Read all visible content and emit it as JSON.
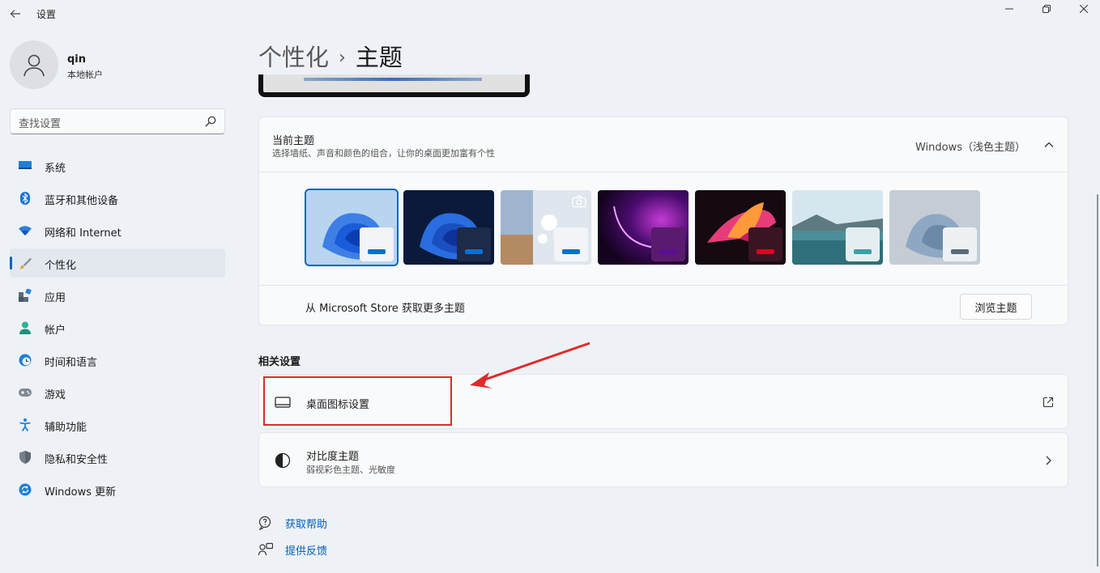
{
  "window": {
    "title": "设置",
    "back_icon": "back-arrow-icon",
    "controls": [
      "minimize-icon",
      "maximize-icon",
      "close-icon"
    ]
  },
  "user": {
    "name": "qin",
    "account_type": "本地帐户"
  },
  "search": {
    "placeholder": "查找设置"
  },
  "sidebar": {
    "items": [
      {
        "label": "系统",
        "icon": "system-icon",
        "active": false
      },
      {
        "label": "蓝牙和其他设备",
        "icon": "bluetooth-icon",
        "active": false
      },
      {
        "label": "网络和 Internet",
        "icon": "wifi-icon",
        "active": false
      },
      {
        "label": "个性化",
        "icon": "brush-icon",
        "active": true
      },
      {
        "label": "应用",
        "icon": "apps-icon",
        "active": false
      },
      {
        "label": "帐户",
        "icon": "account-icon",
        "active": false
      },
      {
        "label": "时间和语言",
        "icon": "globe-clock-icon",
        "active": false
      },
      {
        "label": "游戏",
        "icon": "gamepad-icon",
        "active": false
      },
      {
        "label": "辅助功能",
        "icon": "accessibility-icon",
        "active": false
      },
      {
        "label": "隐私和安全性",
        "icon": "shield-icon",
        "active": false
      },
      {
        "label": "Windows 更新",
        "icon": "update-icon",
        "active": false
      }
    ]
  },
  "breadcrumb": {
    "parent": "个性化",
    "separator": "›",
    "current": "主题"
  },
  "current_theme": {
    "title": "当前主题",
    "description": "选择墙纸、声音和颜色的组合，让你的桌面更加富有个性",
    "value": "Windows（浅色主题）",
    "themes": [
      {
        "name": "windows-light",
        "selected": true,
        "bar_color": "#0a6fd1"
      },
      {
        "name": "windows-dark",
        "selected": false,
        "bar_color": "#0a6fd1"
      },
      {
        "name": "glow",
        "selected": false,
        "bar_color": "#0a6fd1"
      },
      {
        "name": "captured-motion",
        "selected": false,
        "bar_color": "#5a0f96"
      },
      {
        "name": "flow",
        "selected": false,
        "bar_color": "#e0001f"
      },
      {
        "name": "sunrise",
        "selected": false,
        "bar_color": "#3aa0a8"
      },
      {
        "name": "bloom",
        "selected": false,
        "bar_color": "#5d6a78"
      }
    ],
    "store_text": "从 Microsoft Store 获取更多主题",
    "browse_button": "浏览主题"
  },
  "related_settings": {
    "title": "相关设置",
    "items": [
      {
        "title": "桌面图标设置",
        "subtitle": "",
        "icon": "monitor-icon",
        "trail_icon": "external-link-icon"
      },
      {
        "title": "对比度主题",
        "subtitle": "弱视彩色主题、光敏度",
        "icon": "contrast-icon",
        "trail_icon": "chevron-right-icon"
      }
    ]
  },
  "links": [
    {
      "label": "获取帮助",
      "icon": "help-icon"
    },
    {
      "label": "提供反馈",
      "icon": "feedback-icon"
    }
  ],
  "accent_color": "#0067c0",
  "annotation_color": "#e02a2a"
}
